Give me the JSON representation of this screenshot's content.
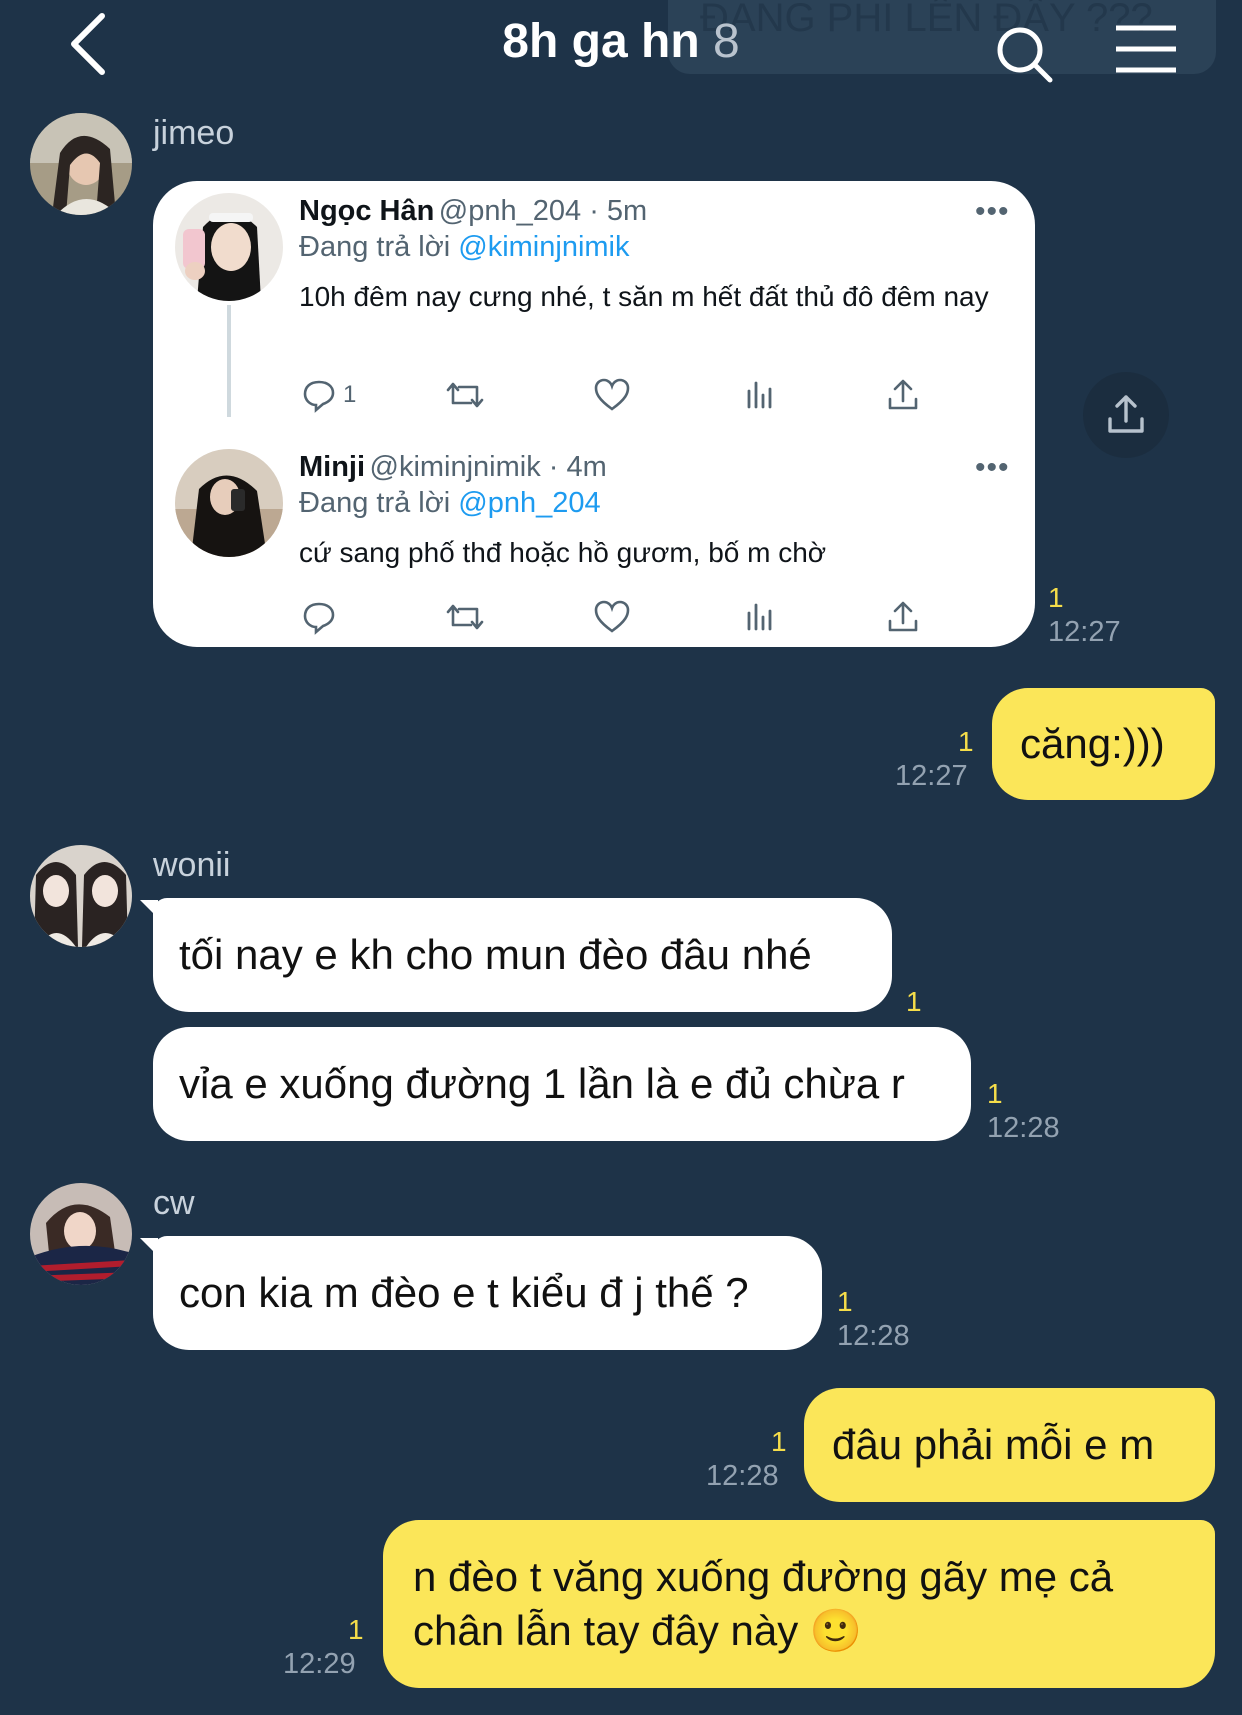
{
  "header": {
    "title": "8h ga hn",
    "member_count": "8",
    "ghost_text": "ĐANG PHI LÊN ĐÂY ???"
  },
  "messages": {
    "jimeo": {
      "sender": "jimeo",
      "unread": "1",
      "time": "12:27",
      "tweet1": {
        "name": "Ngọc Hân",
        "handle": "@pnh_204 · 5m",
        "reply_prefix": "Đang trả lời",
        "reply_to": "@kiminjnimik",
        "body": "10h đêm nay cưng nhé, t săn m hết đất thủ đô đêm nay",
        "reply_count": "1",
        "more": "•••"
      },
      "tweet2": {
        "name": "Minji",
        "handle": "@kiminjnimik · 4m",
        "reply_prefix": "Đang trả lời",
        "reply_to": "@pnh_204",
        "body": "cứ sang phố thđ hoặc hồ gươm, bố m chờ",
        "more": "•••"
      }
    },
    "me1": {
      "text": "căng:)))",
      "unread": "1",
      "time": "12:27"
    },
    "wonii": {
      "sender": "wonii",
      "msg1": "tối nay e kh cho mun đèo đâu nhé",
      "msg1_unread": "1",
      "msg2": "vỉa e xuống đường 1 lần là e đủ chừa r",
      "msg2_unread": "1",
      "time": "12:28"
    },
    "cw": {
      "sender": "cw",
      "msg": "con kia m đèo e t kiểu đ j thế ?",
      "unread": "1",
      "time": "12:28"
    },
    "me2": {
      "text": "đâu phải mỗi e m",
      "unread": "1",
      "time": "12:28"
    },
    "me3": {
      "line1": "n đèo t văng xuống đường gãy mẹ cả",
      "line2": "chân lẫn tay đây này 🙂",
      "unread": "1",
      "time": "12:29"
    }
  },
  "colors": {
    "background": "#1e3348",
    "outgoing_bubble": "#fbe659",
    "incoming_bubble": "#ffffff",
    "unread": "#f5dd4a",
    "mention": "#1d9bf0"
  }
}
